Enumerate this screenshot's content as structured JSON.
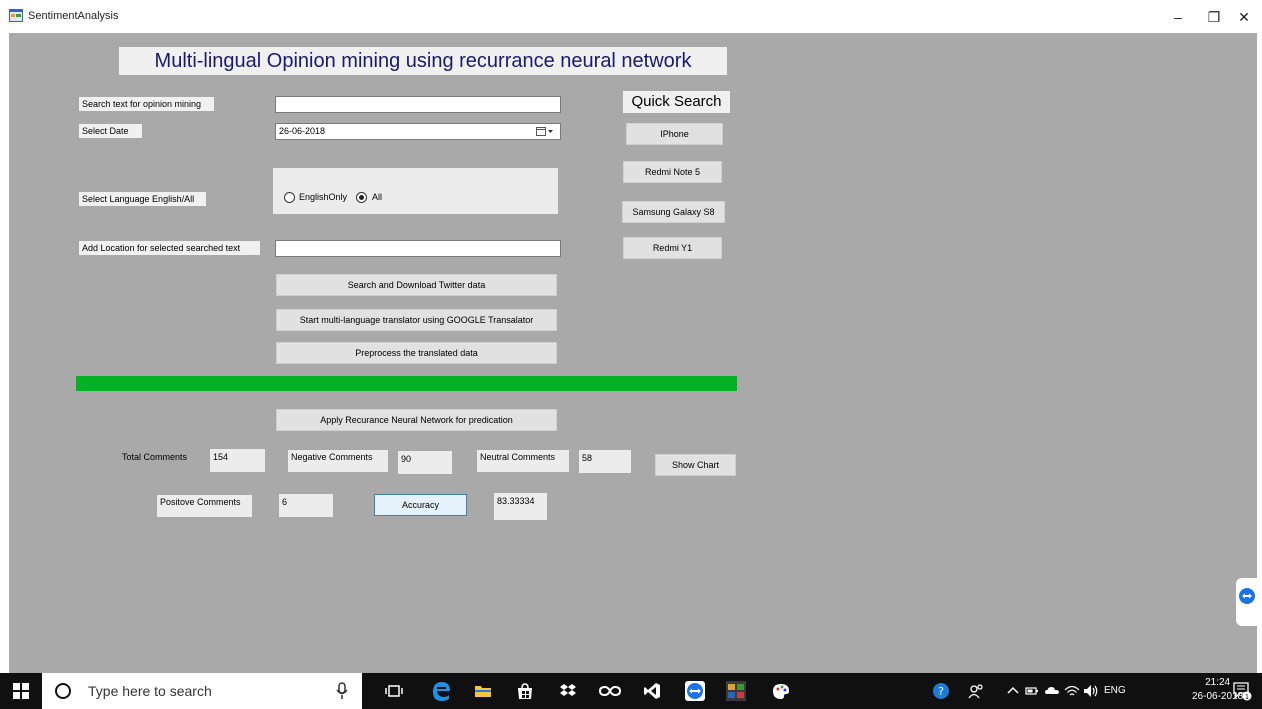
{
  "window": {
    "title": "SentimentAnalysis",
    "minimize": "–",
    "maximize": "❐",
    "close": "✕"
  },
  "heading": "Multi-lingual Opinion mining using recurrance neural network",
  "form": {
    "search_label": "Search text for opinion mining",
    "search_value": "",
    "date_label": "Select Date",
    "date_value": "26-06-2018",
    "language_label": "Select Language English/All",
    "language_options": [
      "EnglishOnly",
      "All"
    ],
    "language_selected": "All",
    "location_label": "Add Location for selected searched text",
    "location_value": ""
  },
  "quick_search": {
    "title": "Quick Search",
    "items": [
      "IPhone",
      "Redmi Note 5",
      "Samsung Galaxy S8",
      "Redmi Y1"
    ]
  },
  "actions": {
    "download": "Search and Download Twitter data",
    "translate": "Start multi-language translator using GOOGLE Transalator",
    "preprocess": "Preprocess the translated data",
    "apply_rnn": "Apply Recurance Neural Network for predication",
    "show_chart": "Show Chart",
    "accuracy": "Accuracy"
  },
  "progress": {
    "value_percent": 100,
    "color": "#06b025"
  },
  "results": {
    "total_label": "Total Comments",
    "total_value": "154",
    "negative_label": "Negative Comments",
    "negative_value": "90",
    "neutral_label": "Neutral Comments",
    "neutral_value": "58",
    "positive_label": "Positove Comments",
    "positive_value": "6",
    "accuracy_value": "83.33334"
  },
  "taskbar": {
    "search_placeholder": "Type here to search",
    "language": "ENG",
    "time": "21:24",
    "date": "26-06-2018",
    "notification_count": "1"
  },
  "colors": {
    "client_bg": "#a9a9a9",
    "heading_text": "#1a1a6e",
    "taskbar_bg": "#101010"
  }
}
